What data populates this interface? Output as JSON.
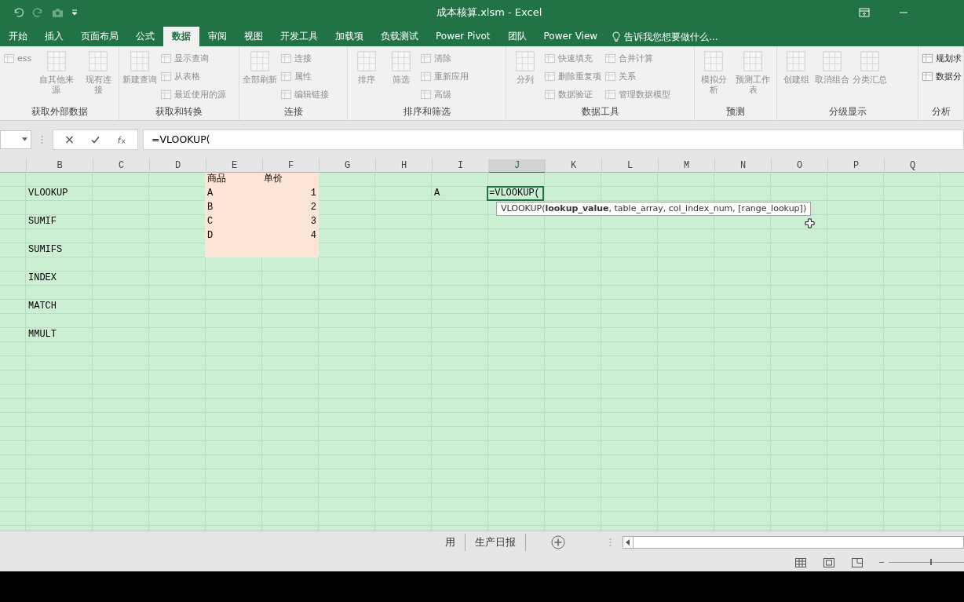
{
  "window": {
    "title": "成本核算.xlsm - Excel"
  },
  "tabs": [
    {
      "label": "开始",
      "selected": false
    },
    {
      "label": "插入",
      "selected": false
    },
    {
      "label": "页面布局",
      "selected": false
    },
    {
      "label": "公式",
      "selected": false
    },
    {
      "label": "数据",
      "selected": true
    },
    {
      "label": "审阅",
      "selected": false
    },
    {
      "label": "视图",
      "selected": false
    },
    {
      "label": "开发工具",
      "selected": false
    },
    {
      "label": "加载项",
      "selected": false
    },
    {
      "label": "负载测试",
      "selected": false
    },
    {
      "label": "Power Pivot",
      "selected": false
    },
    {
      "label": "团队",
      "selected": false
    },
    {
      "label": "Power View",
      "selected": false
    }
  ],
  "tell_me": {
    "placeholder": "告诉我您想要做什么..."
  },
  "ribbon": {
    "groups": [
      {
        "label": "获取外部数据",
        "columns": [
          {
            "kind": "small",
            "items": [
              {
                "label": "ess",
                "disabled": true
              }
            ]
          },
          {
            "kind": "large",
            "items": [
              {
                "label": "自其他来源",
                "disabled": true
              }
            ]
          },
          {
            "kind": "large",
            "items": [
              {
                "label": "现有连接",
                "disabled": true
              }
            ]
          }
        ]
      },
      {
        "label": "获取和转换",
        "columns": [
          {
            "kind": "large",
            "items": [
              {
                "label": "新建查询",
                "disabled": true
              }
            ]
          },
          {
            "kind": "small",
            "items": [
              {
                "label": "显示查询",
                "disabled": true
              },
              {
                "label": "从表格",
                "disabled": true
              },
              {
                "label": "最近使用的源",
                "disabled": true
              }
            ]
          }
        ]
      },
      {
        "label": "连接",
        "columns": [
          {
            "kind": "large",
            "items": [
              {
                "label": "全部刷新",
                "disabled": true
              }
            ]
          },
          {
            "kind": "small",
            "items": [
              {
                "label": "连接",
                "disabled": true
              },
              {
                "label": "属性",
                "disabled": true
              },
              {
                "label": "编辑链接",
                "disabled": true
              }
            ]
          }
        ]
      },
      {
        "label": "排序和筛选",
        "columns": [
          {
            "kind": "large",
            "items": [
              {
                "label": "排序",
                "disabled": true
              }
            ]
          },
          {
            "kind": "large",
            "items": [
              {
                "label": "筛选",
                "disabled": true
              }
            ]
          },
          {
            "kind": "small",
            "items": [
              {
                "label": "清除",
                "disabled": true
              },
              {
                "label": "重新应用",
                "disabled": true
              },
              {
                "label": "高级",
                "disabled": true
              }
            ]
          }
        ]
      },
      {
        "label": "数据工具",
        "columns": [
          {
            "kind": "large",
            "items": [
              {
                "label": "分列",
                "disabled": true
              }
            ]
          },
          {
            "kind": "small",
            "items": [
              {
                "label": "快速填充",
                "disabled": true
              },
              {
                "label": "删除重复项",
                "disabled": true
              },
              {
                "label": "数据验证",
                "disabled": true
              }
            ]
          },
          {
            "kind": "small",
            "items": [
              {
                "label": "合并计算",
                "disabled": true
              },
              {
                "label": "关系",
                "disabled": true
              },
              {
                "label": "管理数据模型",
                "disabled": true
              }
            ]
          }
        ]
      },
      {
        "label": "预测",
        "columns": [
          {
            "kind": "large",
            "items": [
              {
                "label": "模拟分析",
                "disabled": true
              }
            ]
          },
          {
            "kind": "large",
            "items": [
              {
                "label": "预测工作表",
                "disabled": true
              }
            ]
          }
        ]
      },
      {
        "label": "分级显示",
        "columns": [
          {
            "kind": "large",
            "items": [
              {
                "label": "创建组",
                "disabled": true
              }
            ]
          },
          {
            "kind": "large",
            "items": [
              {
                "label": "取消组合",
                "disabled": true
              }
            ]
          },
          {
            "kind": "large",
            "items": [
              {
                "label": "分类汇总",
                "disabled": true
              }
            ]
          }
        ]
      },
      {
        "label": "分析",
        "columns": [
          {
            "kind": "small",
            "items": [
              {
                "label": "规划求",
                "disabled": false
              },
              {
                "label": "数据分",
                "disabled": false
              }
            ]
          }
        ]
      }
    ]
  },
  "formula_bar": {
    "value": "=VLOOKUP("
  },
  "columns": [
    {
      "label": "B",
      "selected": false
    },
    {
      "label": "C",
      "selected": false
    },
    {
      "label": "D",
      "selected": false
    },
    {
      "label": "E",
      "selected": false
    },
    {
      "label": "F",
      "selected": false
    },
    {
      "label": "G",
      "selected": false
    },
    {
      "label": "H",
      "selected": false
    },
    {
      "label": "I",
      "selected": false
    },
    {
      "label": "J",
      "selected": true
    },
    {
      "label": "K",
      "selected": false
    },
    {
      "label": "L",
      "selected": false
    },
    {
      "label": "M",
      "selected": false
    },
    {
      "label": "N",
      "selected": false
    },
    {
      "label": "O",
      "selected": false
    },
    {
      "label": "P",
      "selected": false
    },
    {
      "label": "Q",
      "selected": false
    }
  ],
  "rows": [
    {
      "cells": {
        "E": {
          "text": "商品",
          "kind": "text",
          "color": "#fce4d6"
        },
        "F": {
          "text": "单价",
          "kind": "text",
          "color": "#fce4d6"
        }
      }
    },
    {
      "cells": {
        "B": {
          "text": "VLOOKUP",
          "kind": "text"
        },
        "E": {
          "text": "A",
          "kind": "text",
          "color": "#fce4d6"
        },
        "F": {
          "text": "1",
          "kind": "number",
          "color": "#fce4d6"
        },
        "I": {
          "text": "A",
          "kind": "text"
        },
        "J": {
          "text": "=VLOOKUP(",
          "kind": "editing"
        }
      }
    },
    {
      "cells": {
        "E": {
          "text": "B",
          "kind": "text",
          "color": "#fce4d6"
        },
        "F": {
          "text": "2",
          "kind": "number",
          "color": "#fce4d6"
        }
      }
    },
    {
      "cells": {
        "B": {
          "text": "SUMIF",
          "kind": "text"
        },
        "E": {
          "text": "C",
          "kind": "text",
          "color": "#fce4d6"
        },
        "F": {
          "text": "3",
          "kind": "number",
          "color": "#fce4d6"
        }
      }
    },
    {
      "cells": {
        "E": {
          "text": "D",
          "kind": "text",
          "color": "#fce4d6"
        },
        "F": {
          "text": "4",
          "kind": "number",
          "color": "#fce4d6"
        }
      }
    },
    {
      "cells": {
        "B": {
          "text": "SUMIFS",
          "kind": "text"
        },
        "E": {
          "color": "#fce4d6"
        },
        "F": {
          "color": "#fce4d6"
        }
      }
    },
    {},
    {
      "cells": {
        "B": {
          "text": "INDEX",
          "kind": "text"
        }
      }
    },
    {},
    {
      "cells": {
        "B": {
          "text": "MATCH",
          "kind": "text"
        }
      }
    },
    {},
    {
      "cells": {
        "B": {
          "text": "MMULT",
          "kind": "text"
        }
      }
    },
    {},
    {},
    {},
    {},
    {},
    {},
    {},
    {},
    {},
    {},
    {},
    {},
    {}
  ],
  "tooltip": {
    "text": "VLOOKUP(**lookup_value**, table_array, col_index_num, [range_lookup])"
  },
  "sheet_tabs": [
    {
      "label": "用",
      "selected": false
    },
    {
      "label": "生产日报",
      "selected": false
    }
  ],
  "zoom": {
    "level": 0.55
  }
}
